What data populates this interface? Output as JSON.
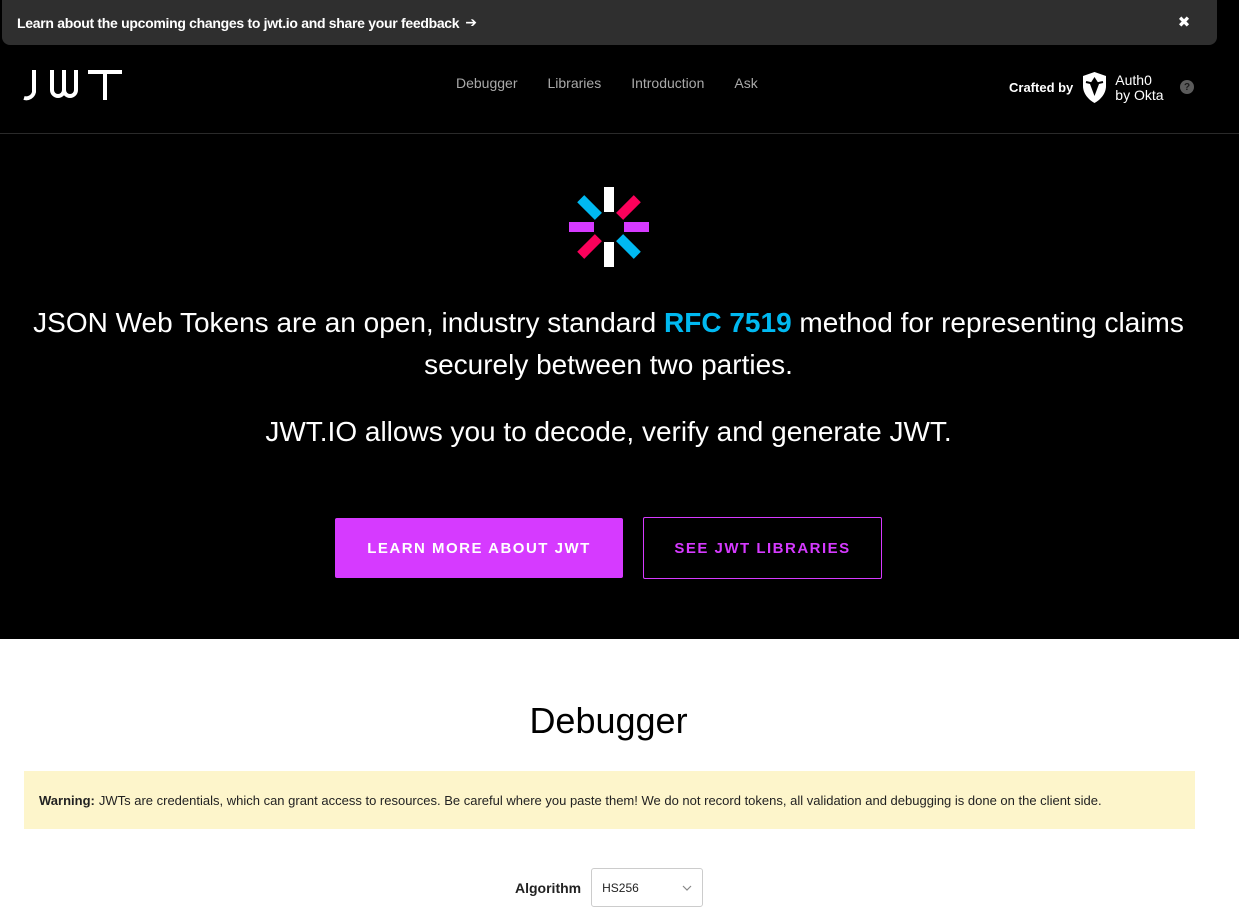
{
  "announcement": {
    "text": "Learn about the upcoming changes to jwt.io and share your feedback",
    "arrow": "➔",
    "close": "✖"
  },
  "header": {
    "nav": [
      "Debugger",
      "Libraries",
      "Introduction",
      "Ask"
    ],
    "crafted_by": "Crafted by",
    "brand_line1": "Auth0",
    "brand_line2": "by Okta",
    "help": "?"
  },
  "hero": {
    "headline_before": "JSON Web Tokens are an open, industry standard ",
    "rfc_link": "RFC 7519",
    "headline_after": " method for representing claims securely between two parties.",
    "subline": "JWT.IO allows you to decode, verify and generate JWT.",
    "primary_button": "LEARN MORE ABOUT JWT",
    "secondary_button": "SEE JWT LIBRARIES"
  },
  "debugger": {
    "title": "Debugger",
    "warning_label": "Warning:",
    "warning_text": "JWTs are credentials, which can grant access to resources. Be careful where you paste them! We do not record tokens, all validation and debugging is done on the client side.",
    "algorithm_label": "Algorithm",
    "algorithm_value": "HS256"
  },
  "colors": {
    "accent": "#d63aff",
    "link": "#00b9f1",
    "warning_bg": "#fdf5cb"
  }
}
